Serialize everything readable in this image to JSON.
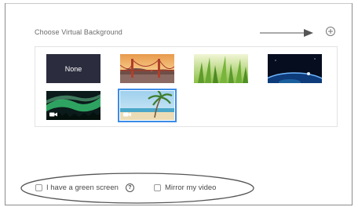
{
  "section": {
    "title": "Choose Virtual Background"
  },
  "add_button": {
    "icon": "plus-circle-icon"
  },
  "annotation": {
    "icon": "arrow-right-icon",
    "color": "#555555"
  },
  "backgrounds": [
    {
      "label": "None",
      "kind": "none",
      "selected": false,
      "is_video": false
    },
    {
      "label": "",
      "kind": "golden-gate-bridge",
      "selected": false,
      "is_video": false
    },
    {
      "label": "",
      "kind": "grass",
      "selected": false,
      "is_video": false
    },
    {
      "label": "",
      "kind": "earth-from-space",
      "selected": false,
      "is_video": false
    },
    {
      "label": "",
      "kind": "aurora",
      "selected": false,
      "is_video": true
    },
    {
      "label": "",
      "kind": "beach",
      "selected": true,
      "is_video": true
    }
  ],
  "options": {
    "green_screen_label": "I have a green screen",
    "green_screen_checked": false,
    "help_icon": "question-circle-icon",
    "help_glyph": "?",
    "mirror_label": "Mirror my video",
    "mirror_checked": false
  },
  "colors": {
    "selection": "#3c8ce7",
    "none_tile_bg": "#2b2c3e",
    "ellipse": "#555555"
  }
}
